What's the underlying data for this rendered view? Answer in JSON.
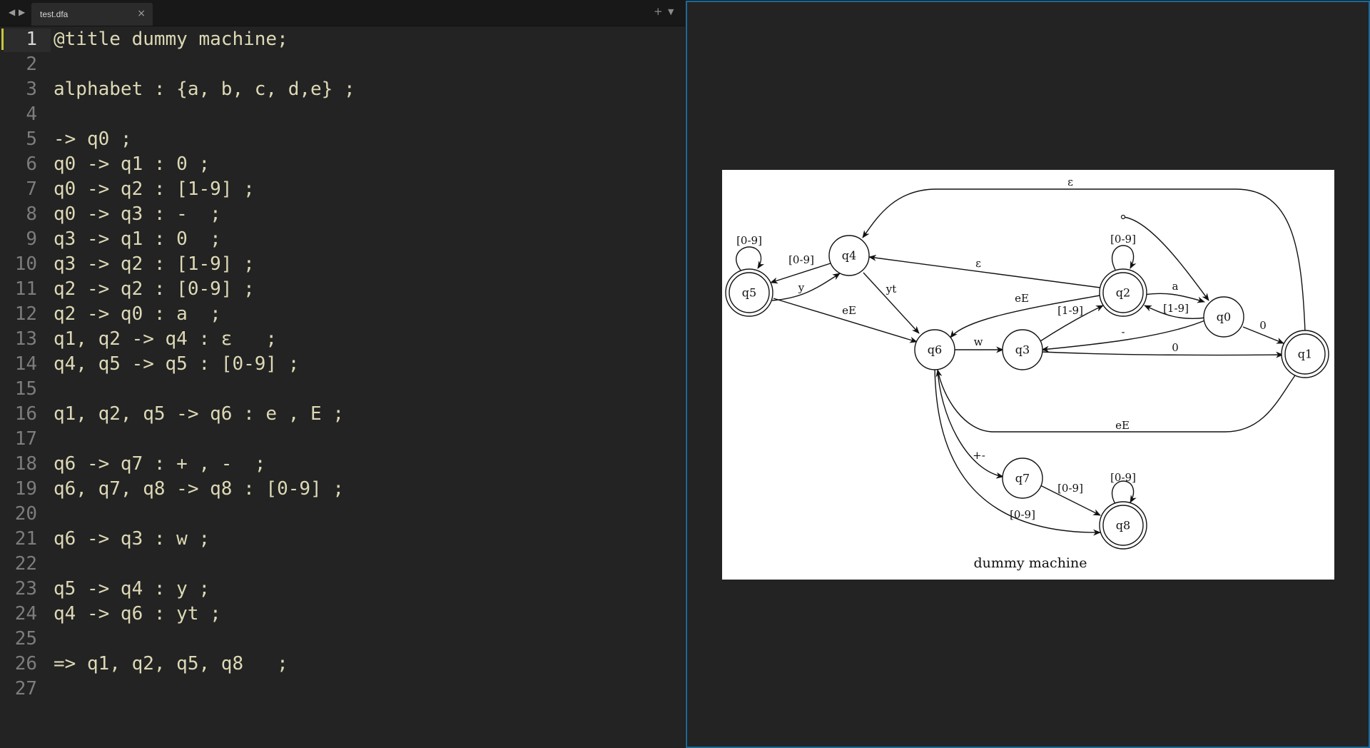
{
  "editor": {
    "nav_back_icon": "◀",
    "nav_forward_icon": "▶",
    "tab": {
      "title": "test.dfa",
      "close_icon": "×"
    },
    "add_tab_icon": "+",
    "tab_menu_icon": "▼",
    "active_line": 1,
    "lines": [
      "@title dummy machine;",
      "",
      "alphabet : {a, b, c, d,e} ;",
      "",
      "-> q0 ;",
      "q0 -> q1 : 0 ;",
      "q0 -> q2 : [1-9] ;",
      "q0 -> q3 : -  ;",
      "q3 -> q1 : 0  ;",
      "q3 -> q2 : [1-9] ;",
      "q2 -> q2 : [0-9] ;",
      "q2 -> q0 : a  ;",
      "q1, q2 -> q4 : ε   ;",
      "q4, q5 -> q5 : [0-9] ;",
      "",
      "q1, q2, q5 -> q6 : e , E ;",
      "",
      "q6 -> q7 : + , -  ;",
      "q6, q7, q8 -> q8 : [0-9] ;",
      "",
      "q6 -> q3 : w ;",
      "",
      "q5 -> q4 : y ;",
      "q4 -> q6 : yt ;",
      "",
      "=> q1, q2, q5, q8   ;",
      ""
    ]
  },
  "diagram": {
    "title": "dummy machine",
    "states": {
      "q0": "q0",
      "q1": "q1",
      "q2": "q2",
      "q3": "q3",
      "q4": "q4",
      "q5": "q5",
      "q6": "q6",
      "q7": "q7",
      "q8": "q8"
    },
    "accepting_states": [
      "q1",
      "q2",
      "q5",
      "q8"
    ],
    "edge_labels": {
      "epsilon": "ε",
      "q5_self": "[0-9]",
      "q4_q5": "[0-9]",
      "q2_self": "[0-9]",
      "q5_q4": "y",
      "q4_q6": "yt",
      "q2_q4": "ε",
      "q2_q0": "a",
      "q2_q6": "eE",
      "q5_q6": "eE",
      "q3_q2": "[1-9]",
      "q0_q2": "[1-9]",
      "q6_q3": "w",
      "q0_q3": "-",
      "q0_q1": "0",
      "q3_q1": "0",
      "q1_q6": "eE",
      "q6_q7": "+-",
      "q7_q8": "[0-9]",
      "q8_self": "[0-9]",
      "q6_q8": "[0-9]"
    }
  },
  "colors": {
    "editor_bg": "#232323",
    "code_text": "#ddd9b6",
    "line_number": "#7d7d7d",
    "active_line_marker": "#c8c83a",
    "preview_border": "#1d6a99",
    "diagram_bg": "#ffffff"
  }
}
